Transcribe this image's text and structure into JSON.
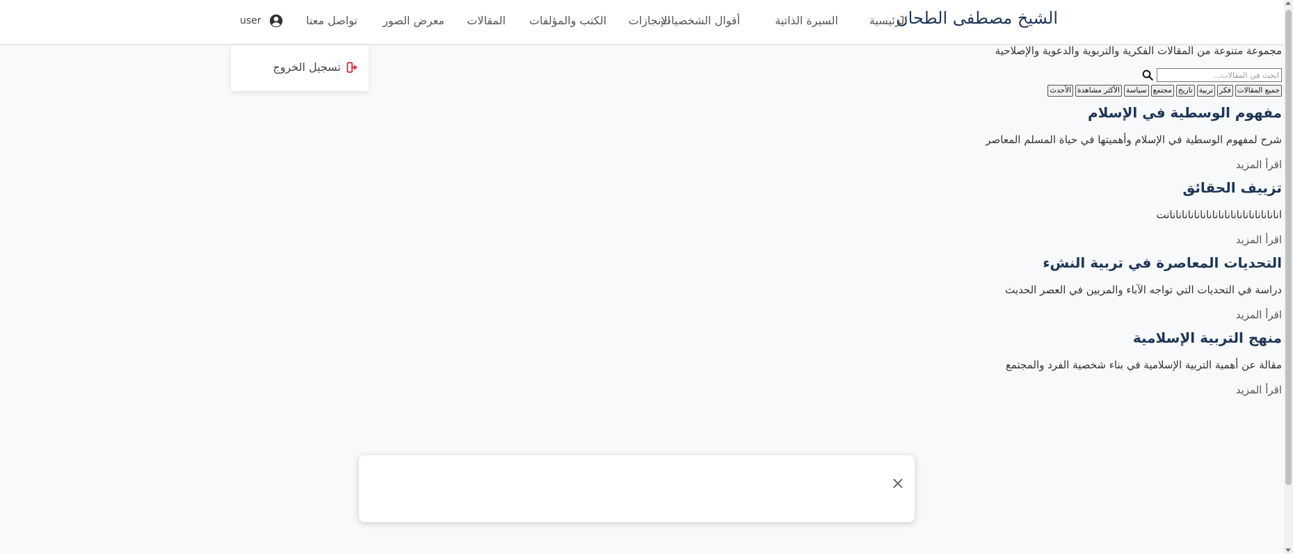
{
  "nav": {
    "brand": "الشيخ مصطفى الطحان",
    "items": [
      "الرئيسية",
      "السيرة الذاتية",
      "أقوال الشخصيات",
      "الإنجازات",
      "الكتب والمؤلفات",
      "المقالات",
      "معرض الصور",
      "تواصل معنا"
    ],
    "user_label": "user",
    "icon": "account-circle-icon"
  },
  "dropdown": {
    "logout_label": "تسجيل الخروج",
    "logout_icon": "sign-out-icon",
    "logout_color": "#dc3545"
  },
  "main": {
    "intro": "مجموعة متنوعة من المقالات الفكرية والتربوية والدعوية والإصلاحية",
    "search_placeholder": "ابحث في المقالات...",
    "filters": [
      "جميع المقالات",
      "فكر",
      "تربية",
      "تاريخ",
      "مجتمع",
      "سياسة",
      "الأكثر مشاهدة",
      "الأحدث"
    ],
    "articles": [
      {
        "title": "مفهوم الوسطية في الإسلام",
        "summary": "شرح لمفهوم الوسطية في الإسلام وأهميتها في حياة المسلم المعاصر",
        "read_more": "اقرأ المزيد"
      },
      {
        "title": "تزييف الحقائق",
        "summary": "انانانانانانانانانانانانانانانانانانانت",
        "read_more": "اقرأ المزيد"
      },
      {
        "title": "التحديات المعاصرة في تربية النشء",
        "summary": "دراسة في التحديات التي تواجه الآباء والمربين في العصر الحديث",
        "read_more": "اقرأ المزيد"
      },
      {
        "title": "منهج التربية الإسلامية",
        "summary": "مقالة عن أهمية التربية الإسلامية في بناء شخصية الفرد والمجتمع",
        "read_more": "اقرأ المزيد"
      }
    ]
  },
  "modal": {
    "close_label": "×"
  },
  "colors": {
    "brand": "#1d3557",
    "background": "#f8f9fa"
  }
}
